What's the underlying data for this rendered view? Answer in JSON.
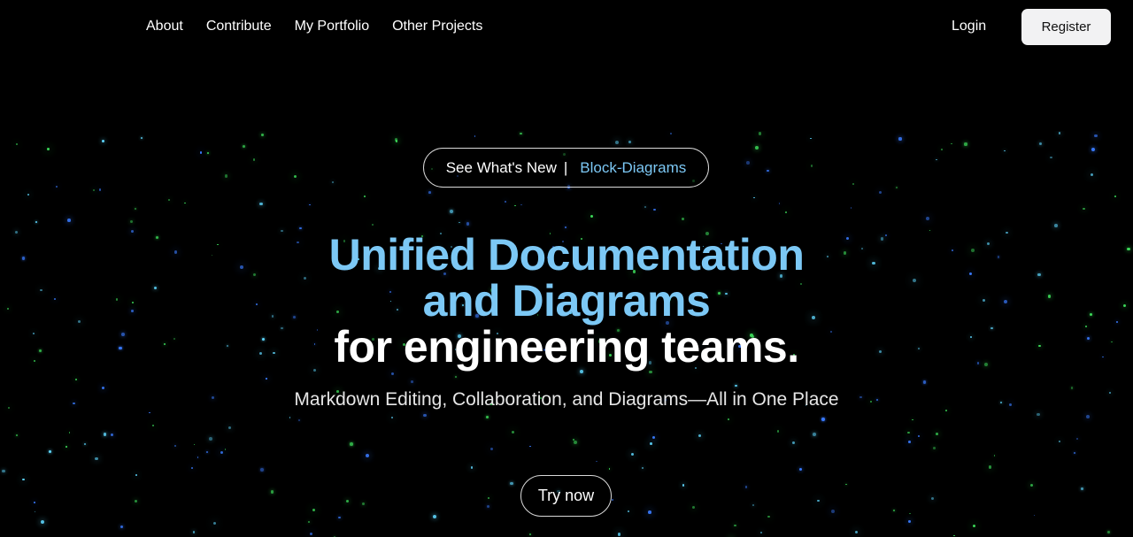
{
  "nav": {
    "links": [
      "About",
      "Contribute",
      "My Portfolio",
      "Other Projects"
    ],
    "login_label": "Login",
    "register_label": "Register"
  },
  "announcement": {
    "lead": "See What's New",
    "separator": "|",
    "link": "Block-Diagrams"
  },
  "hero": {
    "headline_line1": "Unified Documentation",
    "headline_line2": "and Diagrams",
    "headline_line3": "for engineering teams.",
    "subtitle": "Markdown Editing, Collaboration, and Diagrams—All in One Place",
    "cta_label": "Try now"
  },
  "colors": {
    "background": "#000000",
    "accent": "#7cc8f5",
    "star_green": "#3ddc5a",
    "star_blue": "#3a7bff",
    "star_cyan": "#5fd8ff"
  }
}
